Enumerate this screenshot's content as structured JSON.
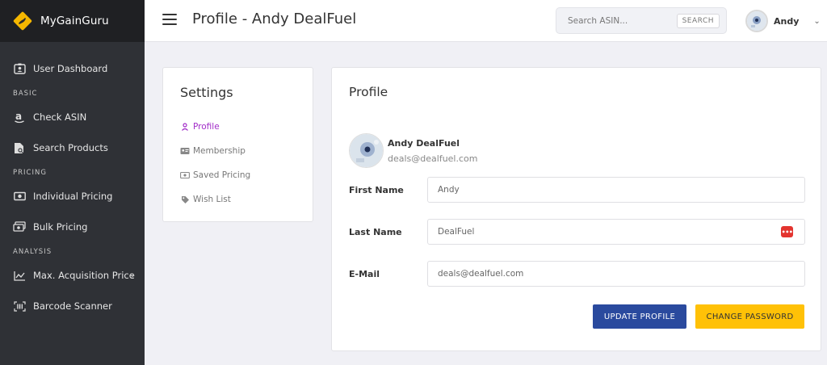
{
  "brand": {
    "name": "MyGainGuru",
    "logo_color": "#f5b700"
  },
  "sidebar": {
    "items": [
      {
        "label": "User Dashboard",
        "icon": "id-card-icon",
        "section": ""
      },
      {
        "section_label": "BASIC"
      },
      {
        "label": "Check ASIN",
        "icon": "amazon-icon"
      },
      {
        "label": "Search Products",
        "icon": "file-search-icon"
      },
      {
        "section_label": "PRICING"
      },
      {
        "label": "Individual Pricing",
        "icon": "money-bill-icon"
      },
      {
        "label": "Bulk Pricing",
        "icon": "money-stack-icon"
      },
      {
        "section_label": "ANALYSIS"
      },
      {
        "label": "Max. Acquisition Price",
        "icon": "line-chart-icon",
        "has_submenu": true
      },
      {
        "label": "Barcode Scanner",
        "icon": "barcode-icon"
      }
    ]
  },
  "header": {
    "title": "Profile - Andy DealFuel",
    "search_placeholder": "Search ASIN...",
    "search_button": "SEARCH",
    "user_name": "Andy"
  },
  "settings": {
    "title": "Settings",
    "items": [
      {
        "label": "Profile",
        "icon": "user-icon",
        "active": true
      },
      {
        "label": "Membership",
        "icon": "id-card-icon",
        "active": false
      },
      {
        "label": "Saved Pricing",
        "icon": "money-bill-icon",
        "active": false
      },
      {
        "label": "Wish List",
        "icon": "tag-icon",
        "active": false
      }
    ]
  },
  "profile": {
    "title": "Profile",
    "name": "Andy DealFuel",
    "email": "deals@dealfuel.com",
    "fields": {
      "first_name_label": "First Name",
      "first_name_value": "Andy",
      "last_name_label": "Last Name",
      "last_name_value": "DealFuel",
      "email_label": "E-Mail",
      "email_value": "deals@dealfuel.com"
    },
    "buttons": {
      "update": "UPDATE PROFILE",
      "change_password": "CHANGE PASSWORD"
    }
  },
  "colors": {
    "sidebar_bg": "#2f3136",
    "accent_purple": "#a12cc8",
    "update_button": "#2a4a9e",
    "change_button": "#ffc107"
  }
}
